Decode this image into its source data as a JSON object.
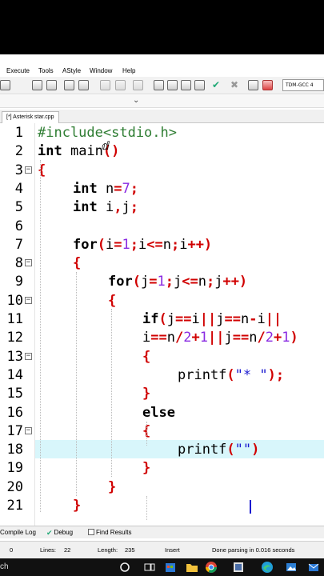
{
  "menubar": {
    "items": [
      "Execute",
      "Tools",
      "AStyle",
      "Window",
      "Help"
    ]
  },
  "toolbar": {
    "compiler": "TDM-GCC 4"
  },
  "editor": {
    "tab_label": "[*] Asterisk star.cpp",
    "lines": [
      {
        "n": "1",
        "tokens": [
          {
            "t": "#include<stdio.h>",
            "c": "pp"
          }
        ]
      },
      {
        "n": "2",
        "tokens": [
          {
            "t": "int",
            "c": "kw"
          },
          {
            "t": " main",
            "c": "plain"
          },
          {
            "t": "()",
            "c": "sym"
          }
        ]
      },
      {
        "n": "3",
        "tokens": [
          {
            "t": "{",
            "c": "sym"
          }
        ]
      },
      {
        "n": "4",
        "tokens": [
          {
            "t": "int",
            "c": "kw"
          },
          {
            "t": " n",
            "c": "plain"
          },
          {
            "t": "=",
            "c": "sym"
          },
          {
            "t": "7",
            "c": "num"
          },
          {
            "t": ";",
            "c": "sym"
          }
        ]
      },
      {
        "n": "5",
        "tokens": [
          {
            "t": "int",
            "c": "kw"
          },
          {
            "t": " i",
            "c": "plain"
          },
          {
            "t": ",",
            "c": "sym"
          },
          {
            "t": "j",
            "c": "plain"
          },
          {
            "t": ";",
            "c": "sym"
          }
        ]
      },
      {
        "n": "6",
        "tokens": []
      },
      {
        "n": "7",
        "tokens": [
          {
            "t": "for",
            "c": "kw"
          },
          {
            "t": "(",
            "c": "sym"
          },
          {
            "t": "i",
            "c": "plain"
          },
          {
            "t": "=",
            "c": "sym"
          },
          {
            "t": "1",
            "c": "num"
          },
          {
            "t": ";",
            "c": "sym"
          },
          {
            "t": "i",
            "c": "plain"
          },
          {
            "t": "<=",
            "c": "sym"
          },
          {
            "t": "n",
            "c": "plain"
          },
          {
            "t": ";",
            "c": "sym"
          },
          {
            "t": "i",
            "c": "plain"
          },
          {
            "t": "++)",
            "c": "sym"
          }
        ]
      },
      {
        "n": "8",
        "tokens": [
          {
            "t": "{",
            "c": "sym"
          }
        ]
      },
      {
        "n": "9",
        "tokens": [
          {
            "t": "for",
            "c": "kw"
          },
          {
            "t": "(",
            "c": "sym"
          },
          {
            "t": "j",
            "c": "plain"
          },
          {
            "t": "=",
            "c": "sym"
          },
          {
            "t": "1",
            "c": "num"
          },
          {
            "t": ";",
            "c": "sym"
          },
          {
            "t": "j",
            "c": "plain"
          },
          {
            "t": "<=",
            "c": "sym"
          },
          {
            "t": "n",
            "c": "plain"
          },
          {
            "t": ";",
            "c": "sym"
          },
          {
            "t": "j",
            "c": "plain"
          },
          {
            "t": "++)",
            "c": "sym"
          }
        ]
      },
      {
        "n": "10",
        "tokens": [
          {
            "t": "{",
            "c": "sym"
          }
        ]
      },
      {
        "n": "11",
        "tokens": [
          {
            "t": "if",
            "c": "kw"
          },
          {
            "t": "(",
            "c": "sym"
          },
          {
            "t": "j",
            "c": "plain"
          },
          {
            "t": "==",
            "c": "sym"
          },
          {
            "t": "i",
            "c": "plain"
          },
          {
            "t": "||",
            "c": "sym"
          },
          {
            "t": "j",
            "c": "plain"
          },
          {
            "t": "==",
            "c": "sym"
          },
          {
            "t": "n",
            "c": "plain"
          },
          {
            "t": "-",
            "c": "sym"
          },
          {
            "t": "i",
            "c": "plain"
          },
          {
            "t": "||",
            "c": "sym"
          }
        ]
      },
      {
        "n": "12",
        "tokens": [
          {
            "t": "i",
            "c": "plain"
          },
          {
            "t": "==",
            "c": "sym"
          },
          {
            "t": "n",
            "c": "plain"
          },
          {
            "t": "/",
            "c": "sym"
          },
          {
            "t": "2",
            "c": "num"
          },
          {
            "t": "+",
            "c": "sym"
          },
          {
            "t": "1",
            "c": "num"
          },
          {
            "t": "||",
            "c": "sym"
          },
          {
            "t": "j",
            "c": "plain"
          },
          {
            "t": "==",
            "c": "sym"
          },
          {
            "t": "n",
            "c": "plain"
          },
          {
            "t": "/",
            "c": "sym"
          },
          {
            "t": "2",
            "c": "num"
          },
          {
            "t": "+",
            "c": "sym"
          },
          {
            "t": "1",
            "c": "num"
          },
          {
            "t": ")",
            "c": "sym"
          }
        ]
      },
      {
        "n": "13",
        "tokens": [
          {
            "t": "{",
            "c": "sym"
          }
        ]
      },
      {
        "n": "14",
        "tokens": [
          {
            "t": "printf",
            "c": "plain"
          },
          {
            "t": "(",
            "c": "sym"
          },
          {
            "t": "\"* \"",
            "c": "str"
          },
          {
            "t": ");",
            "c": "sym"
          }
        ]
      },
      {
        "n": "15",
        "tokens": [
          {
            "t": "}",
            "c": "sym"
          }
        ]
      },
      {
        "n": "16",
        "tokens": [
          {
            "t": "else",
            "c": "kw"
          }
        ]
      },
      {
        "n": "17",
        "tokens": [
          {
            "t": "{",
            "c": "sym"
          }
        ]
      },
      {
        "n": "18",
        "tokens": [
          {
            "t": "printf",
            "c": "plain"
          },
          {
            "t": "(",
            "c": "sym"
          },
          {
            "t": "\"\"",
            "c": "str"
          },
          {
            "t": ")",
            "c": "sym"
          }
        ]
      },
      {
        "n": "19",
        "tokens": [
          {
            "t": "}",
            "c": "sym"
          }
        ]
      },
      {
        "n": "20",
        "tokens": [
          {
            "t": "}",
            "c": "sym"
          }
        ]
      },
      {
        "n": "21",
        "tokens": [
          {
            "t": "}",
            "c": "sym"
          }
        ]
      }
    ]
  },
  "bottom_panel": {
    "tabs": [
      "Compile Log",
      "Debug",
      "Find Results"
    ]
  },
  "status": {
    "col": "0",
    "lines_label": "Lines:",
    "lines_value": "22",
    "length_label": "Length:",
    "length_value": "235",
    "mode": "Insert",
    "message": "Done parsing in 0.016 seconds"
  },
  "taskbar": {
    "search_text": "ch"
  },
  "colors": {
    "active_line": "#d8f6fb",
    "keyword": "#000000",
    "symbol": "#d00000",
    "number": "#8a2be2",
    "string": "#1a1ad0",
    "preprocessor": "#2e7d32"
  }
}
